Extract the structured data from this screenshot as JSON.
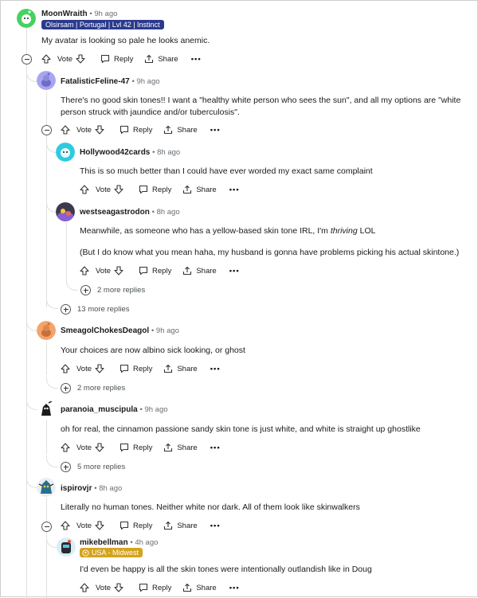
{
  "comments": [
    {
      "user": "MoonWraith",
      "time": "9h ago",
      "flair": "Olsirsam | Portugal | Lvl 42 | Instinct",
      "text": "My avatar is looking so pale he looks anemic."
    },
    {
      "user": "FatalisticFeline-47",
      "time": "9h ago",
      "text1": "There's no good skin tones!! I want a \"healthy white person who sees the sun\", and all my options are \"white",
      "text2": "person struck with jaundice and/or tuberculosis\"."
    },
    {
      "user": "Hollywood42cards",
      "time": "8h ago",
      "text": "This is so much better than I could have ever worded my exact same complaint"
    },
    {
      "user": "westseagastrodon",
      "time": "8h ago",
      "text1_pre": "Meanwhile, as someone who has a yellow-based skin tone IRL, I'm ",
      "text1_em": "thriving",
      "text1_post": " LOL",
      "text2": "(But I do know what you mean haha, my husband is gonna have problems picking his actual skintone.)"
    },
    {
      "user": "SmeagolChokesDeagol",
      "time": "9h ago",
      "text": "Your choices are now albino sick looking, or ghost"
    },
    {
      "user": "paranoia_muscipula",
      "time": "9h ago",
      "text": "oh for real, the cinnamon passione sandy skin tone is just white, and white is straight up ghostlike"
    },
    {
      "user": "ispirovjr",
      "time": "8h ago",
      "text": "Literally no human tones. Neither white nor dark. All of them look like skinwalkers"
    },
    {
      "user": "mikebellman",
      "time": "4h ago",
      "flair": "USA - Midwest",
      "text": "I'd even be happy is all the skin tones were intentionally outlandish like in Doug"
    }
  ],
  "actions": {
    "vote": "Vote",
    "reply": "Reply",
    "share": "Share",
    "more": "•••"
  },
  "more_replies": {
    "westseagastrodon": "2 more replies",
    "feline": "13 more replies",
    "smeagol": "2 more replies",
    "paranoia": "5 more replies"
  },
  "colors": {
    "moon_flair": "#2b3a8c",
    "mike_flair": "#d4a31f",
    "avatar_green": "#46d160",
    "avatar_purple": "#a8a6f0",
    "avatar_teal": "#2ecbe0",
    "avatar_orange": "#f4a46a"
  }
}
